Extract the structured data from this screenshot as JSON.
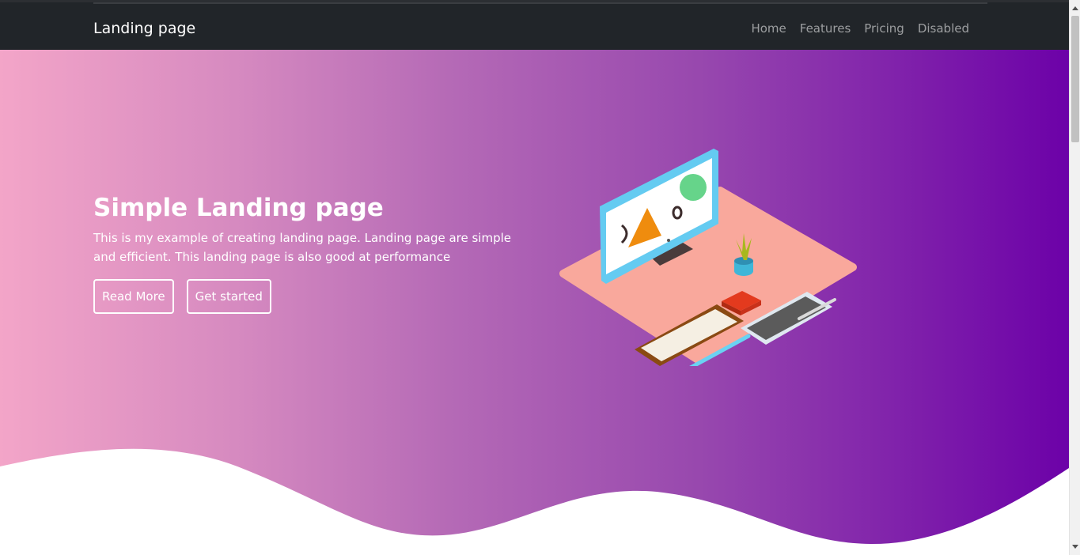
{
  "navbar": {
    "brand": "Landing page",
    "links": [
      {
        "label": "Home"
      },
      {
        "label": "Features"
      },
      {
        "label": "Pricing"
      },
      {
        "label": "Disabled"
      }
    ]
  },
  "hero": {
    "title": "Simple Landing page",
    "text": "This is my example of creating landing page. Landing page are simple and efficient. This landing page is also good at performance",
    "buttons": {
      "read_more": "Read More",
      "get_started": "Get started"
    },
    "illustration": "isometric-desk-illustration"
  },
  "colors": {
    "navbar_bg": "#212529",
    "gradient_start": "#f3a5c8",
    "gradient_end": "#6c01a8"
  }
}
